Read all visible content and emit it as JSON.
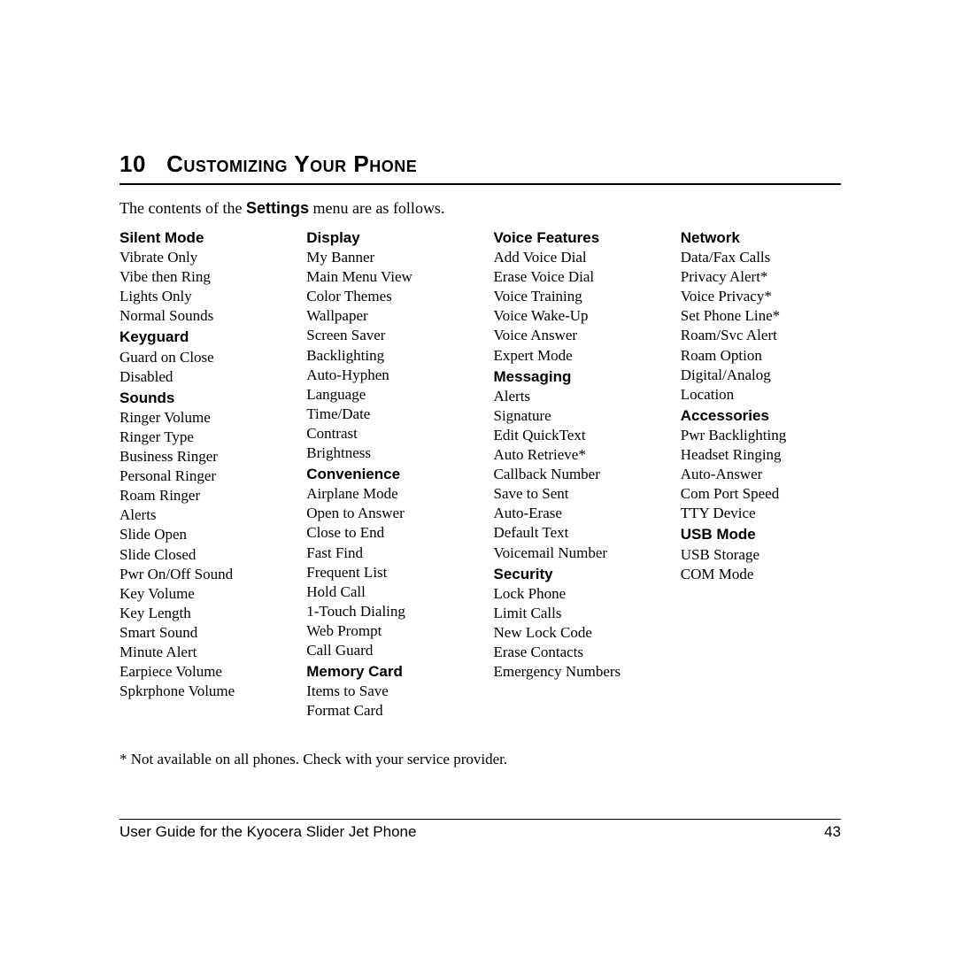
{
  "chapter": {
    "number": "10",
    "title_smallcaps": "Customizing Your Phone"
  },
  "intro_prefix": "The contents of the ",
  "intro_settings": "Settings",
  "intro_suffix": " menu are as follows.",
  "columns": [
    [
      {
        "heading": "Silent Mode",
        "items": [
          "Vibrate Only",
          "Vibe then Ring",
          "Lights Only",
          "Normal Sounds"
        ]
      },
      {
        "heading": "Keyguard",
        "items": [
          "Guard on Close",
          "Disabled"
        ]
      },
      {
        "heading": "Sounds",
        "items": [
          "Ringer Volume",
          "Ringer Type",
          "Business Ringer",
          "Personal Ringer",
          "Roam Ringer",
          "Alerts",
          "Slide Open",
          "Slide Closed",
          "Pwr On/Off Sound",
          "Key Volume",
          "Key Length",
          "Smart Sound",
          "Minute Alert",
          "Earpiece Volume",
          "Spkrphone Volume"
        ]
      }
    ],
    [
      {
        "heading": "Display",
        "items": [
          "My Banner",
          "Main Menu View",
          "Color Themes",
          "Wallpaper",
          "Screen Saver",
          "Backlighting",
          "Auto-Hyphen",
          "Language",
          "Time/Date",
          "Contrast",
          "Brightness"
        ]
      },
      {
        "heading": "Convenience",
        "items": [
          "Airplane Mode",
          "Open to Answer",
          "Close to End",
          "Fast Find",
          "Frequent List",
          "Hold Call",
          "1-Touch Dialing",
          "Web Prompt",
          "Call Guard"
        ]
      },
      {
        "heading": "Memory Card",
        "items": [
          "Items to Save",
          "Format Card"
        ]
      }
    ],
    [
      {
        "heading": "Voice Features",
        "items": [
          "Add Voice Dial",
          "Erase Voice Dial",
          "Voice Training",
          "Voice Wake-Up",
          "Voice Answer",
          "Expert Mode"
        ]
      },
      {
        "heading": "Messaging",
        "items": [
          "Alerts",
          "Signature",
          "Edit QuickText",
          "Auto Retrieve*",
          "Callback Number",
          "Save to Sent",
          "Auto-Erase",
          "Default Text",
          "Voicemail Number"
        ]
      },
      {
        "heading": "Security",
        "items": [
          "Lock Phone",
          "Limit Calls",
          "New Lock Code",
          "Erase Contacts",
          "Emergency Numbers"
        ]
      }
    ],
    [
      {
        "heading": "Network",
        "items": [
          "Data/Fax Calls",
          "Privacy Alert*",
          "Voice Privacy*",
          "Set Phone Line*",
          "Roam/Svc Alert",
          "Roam Option",
          "Digital/Analog",
          "Location"
        ]
      },
      {
        "heading": "Accessories",
        "items": [
          "Pwr Backlighting",
          "Headset Ringing",
          "Auto-Answer",
          "Com Port Speed",
          "TTY Device"
        ]
      },
      {
        "heading": "USB Mode",
        "items": [
          "USB Storage",
          "COM Mode"
        ]
      }
    ]
  ],
  "footnote": "* Not available on all phones. Check with your service provider.",
  "footer": {
    "left": "User Guide for the Kyocera Slider Jet Phone",
    "right": "43"
  }
}
